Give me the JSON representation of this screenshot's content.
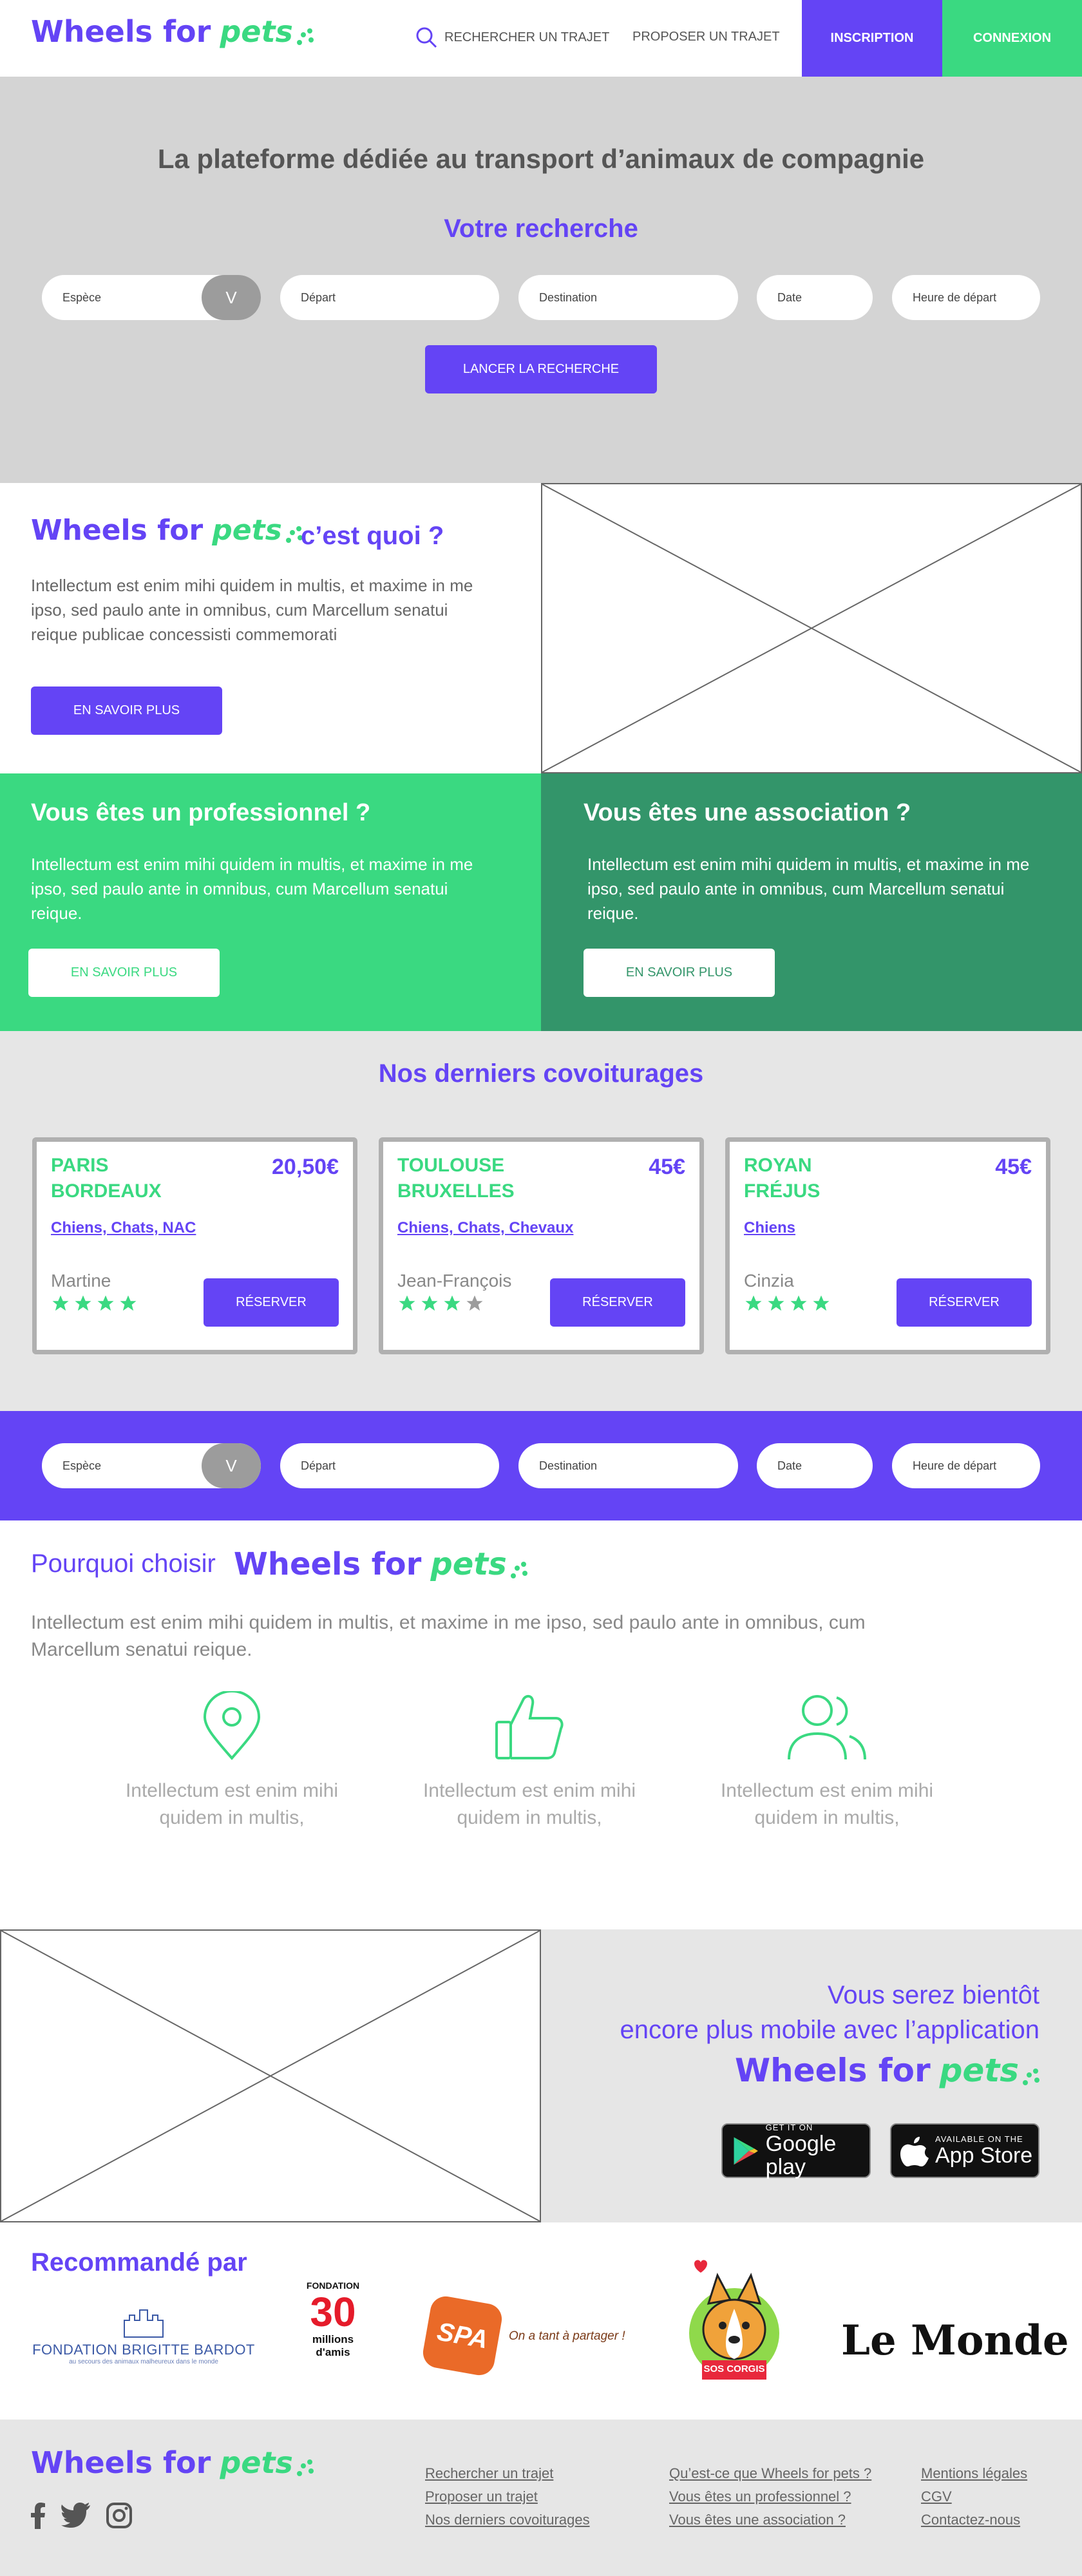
{
  "brand": {
    "wheels": "Wheels for",
    "pets": "pets"
  },
  "header": {
    "search_label": "RECHERCHER UN TRAJET",
    "propose_label": "PROPOSER UN TRAJET",
    "signup_label": "INSCRIPTION",
    "login_label": "CONNEXION"
  },
  "hero": {
    "title": "La plateforme dédiée au transport d’animaux de compagnie",
    "subtitle": "Votre recherche",
    "species_placeholder": "Espèce",
    "select_toggle": "V",
    "departure_placeholder": "Départ",
    "destination_placeholder": "Destination",
    "date_placeholder": "Date",
    "time_placeholder": "Heure de départ",
    "search_button": "LANCER LA RECHERCHE"
  },
  "about": {
    "suffix": "c’est quoi ?",
    "text": "Intellectum est enim mihi quidem in multis, et maxime in me ipso, sed paulo ante in omnibus, cum Marcellum senatui reique publicae concessisti commemorati",
    "button": "EN SAVOIR PLUS"
  },
  "pro": {
    "title": "Vous êtes un professionnel ?",
    "text": "Intellectum est enim mihi quidem in multis, et maxime in me ipso, sed paulo ante in omnibus, cum Marcellum senatui reique.",
    "button": "EN SAVOIR PLUS"
  },
  "asso": {
    "title": "Vous êtes une association ?",
    "text": "Intellectum est enim mihi quidem in multis, et maxime in me ipso, sed paulo ante in omnibus, cum Marcellum senatui reique.",
    "button": "EN SAVOIR PLUS"
  },
  "rides": {
    "title": "Nos derniers covoiturages",
    "items": [
      {
        "from": "PARIS",
        "to": "BORDEAUX",
        "price": "20,50€",
        "species": "Chiens, Chats, NAC",
        "driver": "Martine",
        "rating": 4,
        "button": "RÉSERVER"
      },
      {
        "from": "TOULOUSE",
        "to": "BRUXELLES",
        "price": "45€",
        "species": "Chiens, Chats, Chevaux",
        "driver": "Jean-François",
        "rating": 3,
        "button": "RÉSERVER"
      },
      {
        "from": "ROYAN",
        "to": "FRÉJUS",
        "price": "45€",
        "species": "Chiens",
        "driver": "Cinzia",
        "rating": 4,
        "button": "RÉSERVER"
      }
    ]
  },
  "why": {
    "prefix": "Pourquoi choisir",
    "text": "Intellectum est enim mihi quidem in multis, et maxime in me ipso, sed paulo ante in omnibus, cum Marcellum senatui reique.",
    "features": [
      {
        "icon": "location-pin-icon",
        "text": "Intellectum est enim mihi quidem in multis,"
      },
      {
        "icon": "thumbs-up-icon",
        "text": "Intellectum est enim mihi quidem in multis,"
      },
      {
        "icon": "users-icon",
        "text": "Intellectum est enim mihi quidem in multis,"
      }
    ]
  },
  "app": {
    "line1": "Vous serez bientôt",
    "line2": "encore plus mobile avec l’application",
    "google_small": "GET IT ON",
    "google_big": "Google play",
    "apple_small": "AVAILABLE ON THE",
    "apple_big": "App Store"
  },
  "recommended": {
    "title": "Recommandé par",
    "bardot_name": "FONDATION BRIGITTE BARDOT",
    "bardot_tag": "au secours des animaux malheureux dans le monde",
    "millions_top": "FONDATION",
    "millions_num": "30",
    "millions_name": "millions d'amis",
    "spa_name": "SPA",
    "spa_tag": "On a tant à partager !",
    "corgis_name": "SOS CORGIS",
    "lemonde_name": "Le Monde"
  },
  "footer": {
    "links_col1": [
      "Rechercher un trajet",
      "Proposer un trajet",
      "Nos derniers covoiturages"
    ],
    "links_col2": [
      "Qu’est-ce que Wheels for pets ?",
      "Vous êtes un professionnel ?",
      "Vous êtes une association ?"
    ],
    "links_col3": [
      "Mentions légales",
      "CGV",
      "Contactez-nous"
    ]
  },
  "colors": {
    "purple": "#6444f5",
    "green": "#3ad981",
    "dark_green": "#33956a",
    "grey": "#d4d4d4",
    "light_grey": "#e6e6e6"
  }
}
